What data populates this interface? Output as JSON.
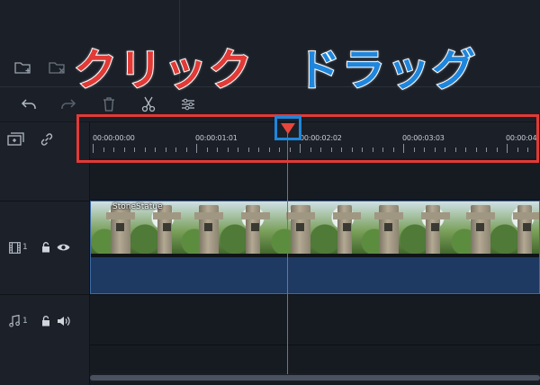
{
  "annotations": {
    "click_word": "クリック",
    "drag_word": "ドラッグ",
    "click_color": "#e23a36",
    "drag_color": "#1f86dc"
  },
  "media_toolbar": {
    "icons": [
      "new-folder-icon",
      "delete-folder-icon"
    ]
  },
  "edit_toolbar": {
    "icons": [
      "undo-icon",
      "redo-icon",
      "trash-icon",
      "cut-icon",
      "adjust-icon",
      "add-track-icon",
      "link-icon"
    ]
  },
  "ruler": {
    "timecodes": [
      "00:00:00:00",
      "00:00:01:01",
      "00:00:02:02",
      "00:00:03:03",
      "00:00:04"
    ]
  },
  "tracks": {
    "video": {
      "number": "1",
      "icons": [
        "film-icon",
        "lock-icon",
        "eye-icon"
      ]
    },
    "audio": {
      "number": "1",
      "icons": [
        "music-note-icon",
        "lock-icon",
        "speaker-icon"
      ]
    }
  },
  "clip": {
    "name": "StoneStatue"
  },
  "colors": {
    "playhead": "#e8453c",
    "clip_fill": "#1e3a62",
    "clip_border": "#3d6aa4"
  }
}
